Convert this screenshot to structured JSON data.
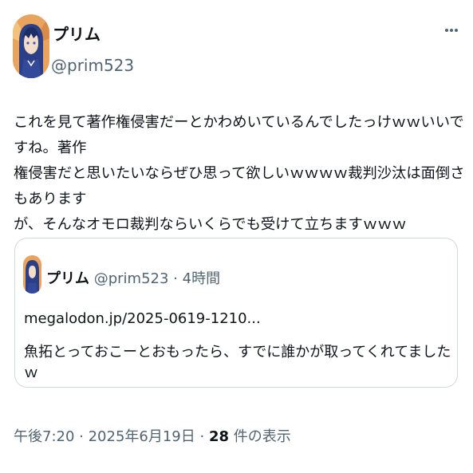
{
  "author": {
    "display_name": "プリム",
    "handle": "@prim523"
  },
  "icons": {
    "more": "more-horizontal-icon"
  },
  "tweet": {
    "text": "これを見て著作権侵害だーとかわめいているんでしたっけｗｗいいですね。著作\n権侵害だと思いたいならぜひ思って欲しいｗｗｗｗ裁判沙汰は面倒さもあります\nが、そんなオモロ裁判ならいくらでも受けて立ちますｗｗｗ"
  },
  "quote": {
    "display_name": "プリム",
    "handle": "@prim523",
    "separator": " · ",
    "time": "4時間",
    "link": "megalodon.jp/2025-0619-1210...",
    "text": "魚拓とっておこーとおもったら、すでに誰かが取ってくれてましたｗ"
  },
  "meta": {
    "time": "午後7:20",
    "separator": " · ",
    "date": "2025年6月19日",
    "separator2": " · ",
    "view_count": "28",
    "view_label": " 件の表示"
  },
  "colors": {
    "text": "#0f1419",
    "secondary": "#536471",
    "border": "#cfd9de",
    "avatar_hair": "#2b3f86",
    "avatar_bg": "#e9a65a"
  }
}
